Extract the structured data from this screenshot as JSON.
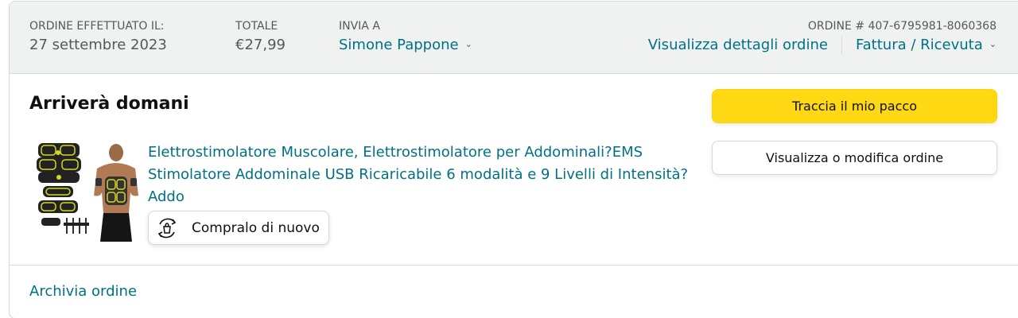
{
  "header": {
    "order_placed_label": "ORDINE EFFETTUATO IL:",
    "order_placed_value": "27 settembre 2023",
    "total_label": "TOTALE",
    "total_value": "€27,99",
    "ship_to_label": "INVIA A",
    "ship_to_value": "Simone Pappone",
    "order_number_label": "ORDINE # 407-6795981-8060368",
    "view_details_link": "Visualizza dettagli ordine",
    "invoice_link": "Fattura / Ricevuta"
  },
  "shipment": {
    "delivery_status": "Arriverà domani",
    "product_title": "Elettrostimolatore Muscolare, Elettrostimolatore per Addominali?EMS Stimolatore Addominale USB Ricaricabile 6 modalità e 9 Livelli di Intensità? Addo",
    "buy_again_label": "Compralo di nuovo",
    "track_package_label": "Traccia il mio pacco",
    "view_edit_order_label": "Visualizza o modifica ordine"
  },
  "footer": {
    "archive_label": "Archivia ordine"
  },
  "icons": {
    "ship_to_chevron": "chevron-down-icon",
    "invoice_chevron": "chevron-down-icon",
    "buy_again_icon": "buy-again-icon"
  },
  "colors": {
    "link": "#007185",
    "primary_button": "#ffd814",
    "header_bg": "#f0f2f2",
    "border": "#d5d9d9"
  }
}
